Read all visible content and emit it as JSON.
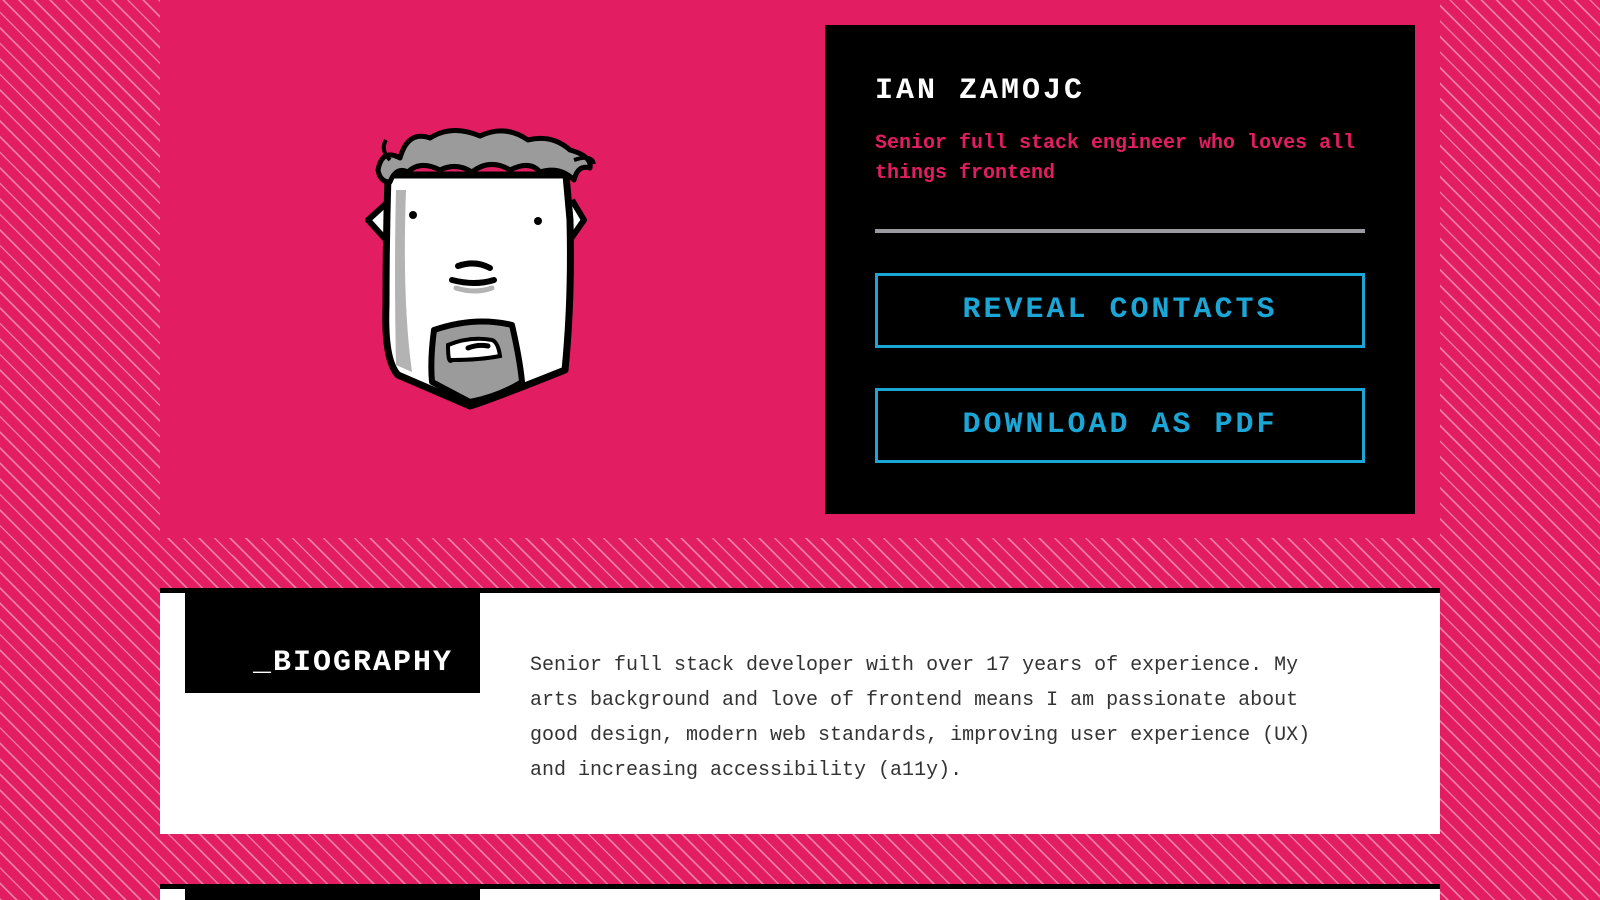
{
  "profile": {
    "name": "IAN ZAMOJC",
    "tagline": "Senior full stack engineer who loves all things frontend",
    "reveal_contacts_label": "REVEAL CONTACTS",
    "download_pdf_label": "DOWNLOAD AS PDF"
  },
  "biography": {
    "heading": "_BIOGRAPHY",
    "text": "Senior full stack developer with over 17 years of experience. My arts background and love of frontend means I am passionate about good design, modern web standards, improving user experience (UX) and increasing accessibility (a11y)."
  },
  "colors": {
    "background": "#e21d62",
    "card": "#000000",
    "accent": "#1ba6d6",
    "divider": "#9a9aa0"
  }
}
